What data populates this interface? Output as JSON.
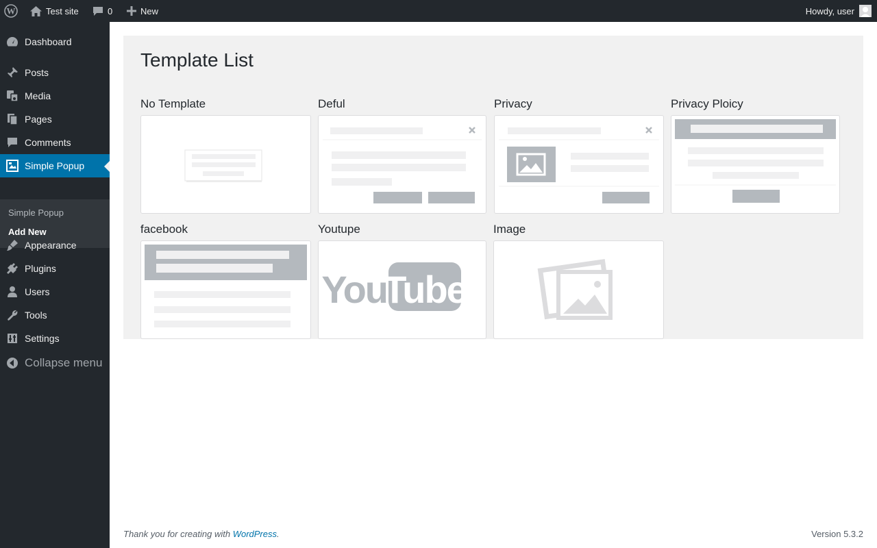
{
  "adminbar": {
    "site_name": "Test site",
    "comments_count": "0",
    "new_label": "New",
    "howdy": "Howdy, user"
  },
  "sidebar": {
    "items": [
      {
        "label": "Dashboard",
        "icon": "dashboard-icon"
      },
      {
        "label": "Posts",
        "icon": "pin-icon"
      },
      {
        "label": "Media",
        "icon": "media-icon"
      },
      {
        "label": "Pages",
        "icon": "pages-icon"
      },
      {
        "label": "Comments",
        "icon": "comment-icon"
      },
      {
        "label": "Simple Popup",
        "icon": "popup-icon",
        "current": true
      },
      {
        "label": "Appearance",
        "icon": "brush-icon"
      },
      {
        "label": "Plugins",
        "icon": "plug-icon"
      },
      {
        "label": "Users",
        "icon": "user-icon"
      },
      {
        "label": "Tools",
        "icon": "wrench-icon"
      },
      {
        "label": "Settings",
        "icon": "settings-icon"
      }
    ],
    "submenu": [
      {
        "label": "Simple Popup"
      },
      {
        "label": "Add New",
        "active": true
      }
    ],
    "collapse_label": "Collapse menu"
  },
  "main": {
    "title": "Template List",
    "templates": [
      {
        "label": "No Template"
      },
      {
        "label": "Deful"
      },
      {
        "label": "Privacy"
      },
      {
        "label": "Privacy Ploicy"
      },
      {
        "label": "facebook"
      },
      {
        "label": "Youtupe"
      },
      {
        "label": "Image"
      }
    ],
    "youtube_text_you": "You",
    "youtube_text_tube": "Tube"
  },
  "footer": {
    "thanks_prefix": "Thank you for creating with ",
    "wordpress_link": "WordPress",
    "thanks_suffix": ".",
    "version": "Version 5.3.2"
  },
  "colors": {
    "admin_dark": "#23282d",
    "accent_blue": "#0073aa",
    "submenu_bg": "#32373c",
    "panel_bg": "#f1f1f1",
    "placeholder_dark": "#b4b9be",
    "placeholder_light": "#f0f0f1"
  }
}
